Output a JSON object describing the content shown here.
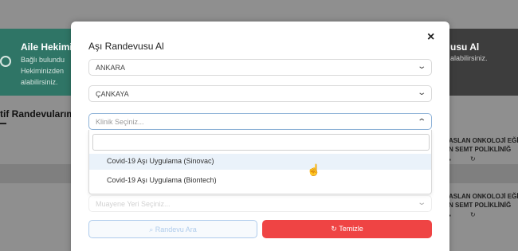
{
  "background": {
    "left_card": {
      "title": "Aile Hekimi",
      "lines": [
        "Bağlı bulundu",
        "Hekiminizden",
        "alabilirsiniz."
      ]
    },
    "right_card": {
      "title": "usu Al",
      "line": "alabilirsiniz."
    },
    "heading": "tif Randevularım",
    "rows": [
      [
        "ASLAN ONKOLOJİ EĞİTİ",
        "N SEMT POLİKLİNİĞ"
      ],
      [
        "ASLAN ONKOLOJİ EĞİTİ",
        "N SEMT POLİKLİNİĞ"
      ]
    ]
  },
  "modal": {
    "title": "Aşı Randevusu Al",
    "close_label": "×",
    "province": "ANKARA",
    "district": "ÇANKAYA",
    "clinic_placeholder": "Klinik Seçiniz...",
    "clinic_options": [
      "Covid-19 Aşı Uygulama (Sinovac)",
      "Covid-19 Aşı Uygulama (Biontech)"
    ],
    "location_placeholder": "Muayene Yeri Seçiniz...",
    "search_button": "Randevu Ara",
    "clear_button": "Temizle"
  },
  "icons": {
    "search": "magnifier",
    "clear": "refresh-arrow",
    "chevron": "chevron"
  }
}
